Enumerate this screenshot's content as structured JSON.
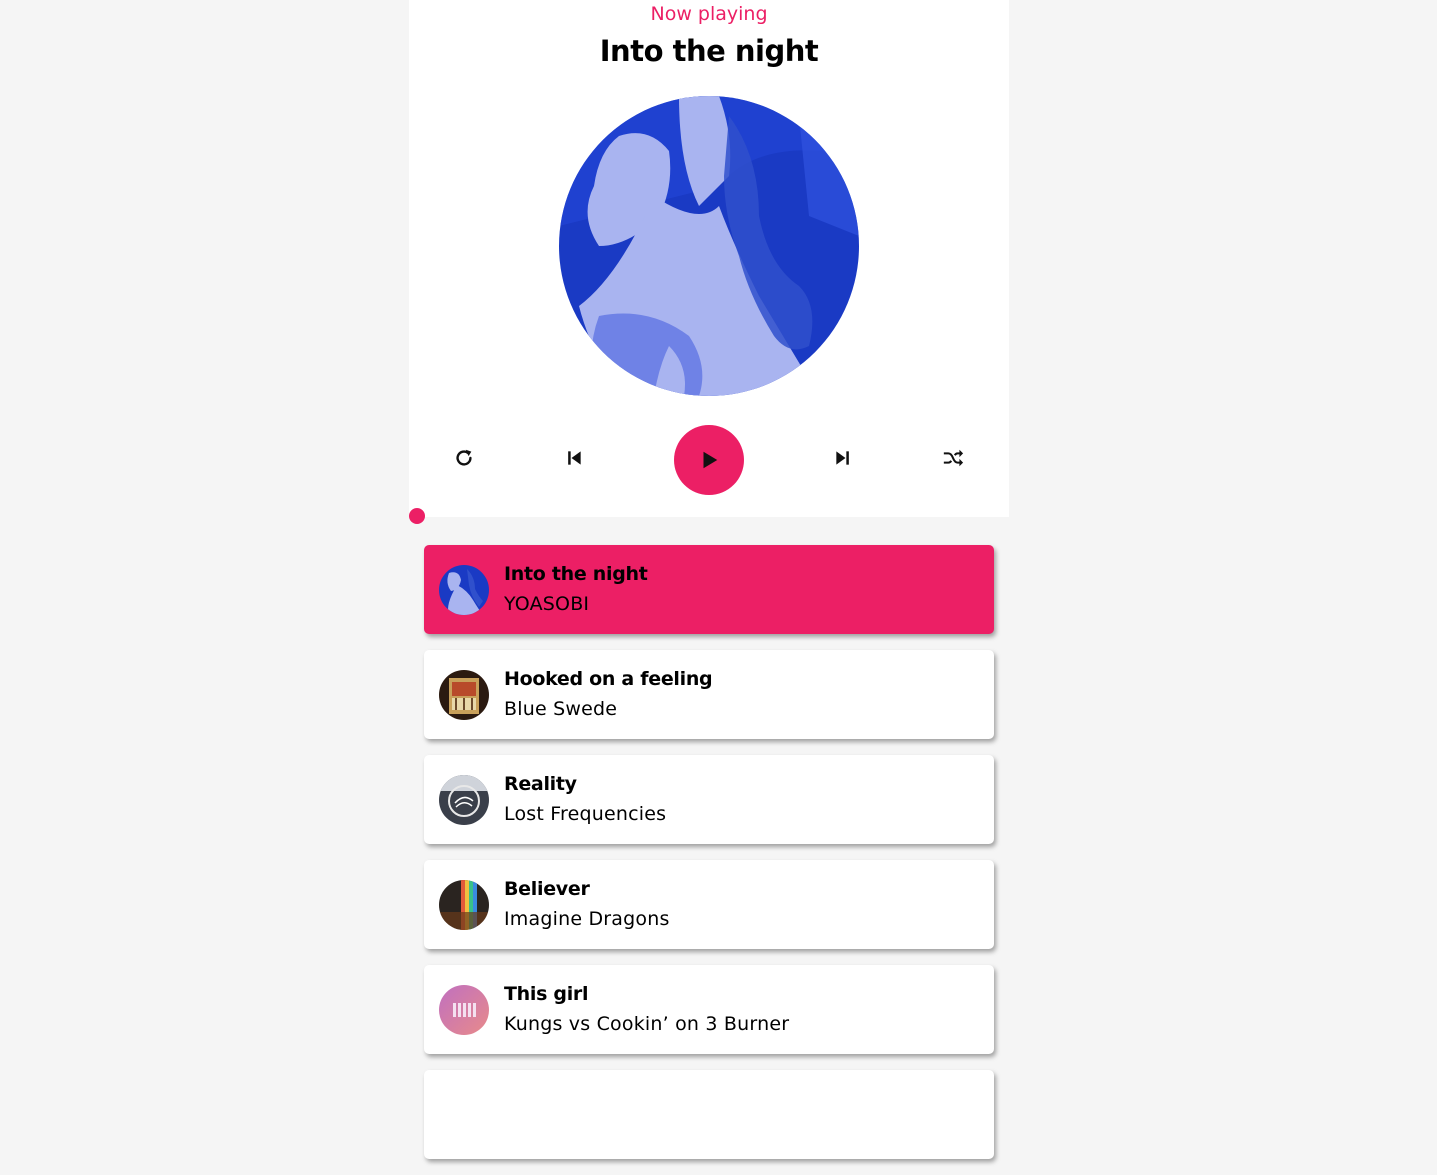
{
  "header": {
    "label": "Now playing",
    "title": "Into the night"
  },
  "controls": {
    "repeat_icon": "repeat-icon",
    "prev_icon": "skip-back-icon",
    "play_icon": "play-icon",
    "next_icon": "skip-forward-icon",
    "shuffle_icon": "shuffle-icon"
  },
  "progress": {
    "value": 0
  },
  "colors": {
    "accent": "#ec1f65",
    "background": "#f5f5f5",
    "card": "#ffffff"
  },
  "playlist": [
    {
      "name": "Into the night",
      "artist": "YOASOBI",
      "active": true
    },
    {
      "name": "Hooked on a feeling",
      "artist": "Blue Swede",
      "active": false
    },
    {
      "name": "Reality",
      "artist": "Lost Frequencies",
      "active": false
    },
    {
      "name": "Believer",
      "artist": "Imagine Dragons",
      "active": false
    },
    {
      "name": "This girl",
      "artist": "Kungs vs Cookin’ on 3 Burner",
      "active": false
    }
  ]
}
